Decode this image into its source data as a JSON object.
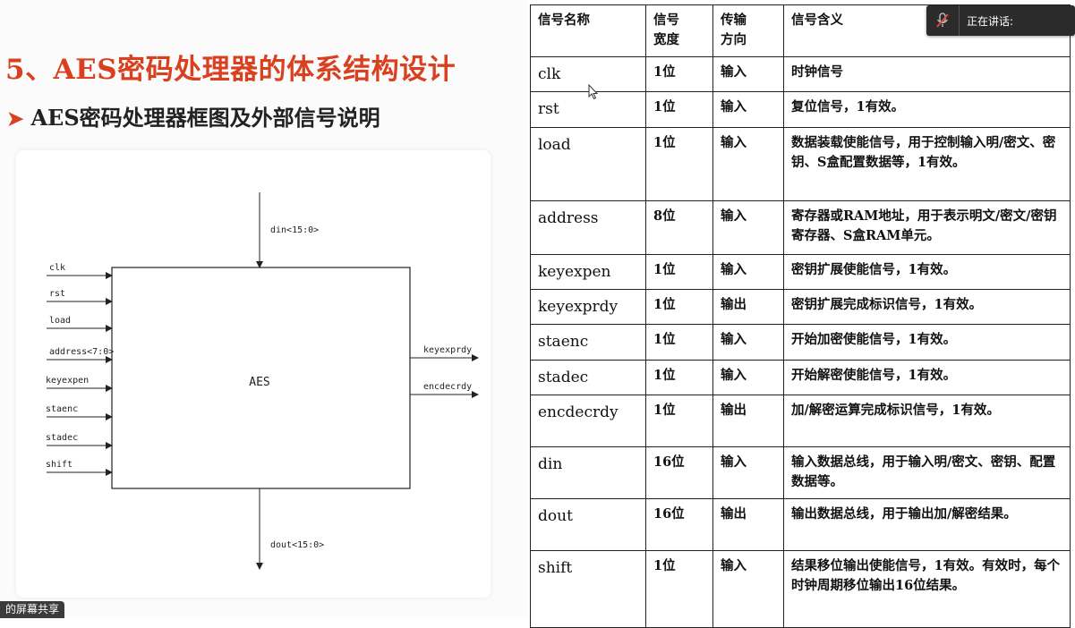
{
  "slide": {
    "title": "5、AES密码处理器的体系结构设计",
    "subtitle": "AES密码处理器框图及外部信号说明",
    "bullet_icon": "arrow-right-bullet"
  },
  "diagram": {
    "block_label": "AES",
    "inputs": [
      "clk",
      "rst",
      "load",
      "address<7:0>",
      "keyexpen",
      "staenc",
      "stadec",
      "shift"
    ],
    "outputs": [
      "keyexprdy",
      "encdecrdy"
    ],
    "top_input": "din<15:0>",
    "bottom_output": "dout<15:0>"
  },
  "table": {
    "headers": [
      "信号名称",
      "信号\n宽度",
      "传输\n方向",
      "信号含义"
    ],
    "rows": [
      {
        "name": "clk",
        "width": "1位",
        "dir": "输入",
        "desc": "时钟信号"
      },
      {
        "name": "rst",
        "width": "1位",
        "dir": "输入",
        "desc": "复位信号，1有效。"
      },
      {
        "name": "load",
        "width": "1位",
        "dir": "输入",
        "desc": "数据装载使能信号，用于控制输入明/密文、密钥、S盒配置数据等，1有效。"
      },
      {
        "name": "address",
        "width": "8位",
        "dir": "输入",
        "desc": "寄存器或RAM地址，用于表示明文/密文/密钥寄存器、S盒RAM单元。"
      },
      {
        "name": "keyexpen",
        "width": "1位",
        "dir": "输入",
        "desc": "密钥扩展使能信号，1有效。"
      },
      {
        "name": "keyexprdy",
        "width": "1位",
        "dir": "输出",
        "desc": "密钥扩展完成标识信号，1有效。"
      },
      {
        "name": "staenc",
        "width": "1位",
        "dir": "输入",
        "desc": "开始加密使能信号，1有效。"
      },
      {
        "name": "stadec",
        "width": "1位",
        "dir": "输入",
        "desc": "开始解密使能信号，1有效。"
      },
      {
        "name": "encdecrdy",
        "width": "1位",
        "dir": "输出",
        "desc": "加/解密运算完成标识信号，1有效。"
      },
      {
        "name": "din",
        "width": "16位",
        "dir": "输入",
        "desc": "输入数据总线，用于输入明/密文、密钥、配置数据等。"
      },
      {
        "name": "dout",
        "width": "16位",
        "dir": "输出",
        "desc": "输出数据总线，用于输出加/解密结果。"
      },
      {
        "name": "shift",
        "width": "1位",
        "dir": "输入",
        "desc": "结果移位输出使能信号，1有效。有效时，每个时钟周期移位输出16位结果。"
      }
    ]
  },
  "overlay": {
    "speaker_label": "正在讲话:",
    "speaker_icon": "mic-muted-icon",
    "share_tag": "的屏幕共享"
  },
  "colors": {
    "title": "#d9401f",
    "overlay_bg": "#2b2b2b"
  }
}
